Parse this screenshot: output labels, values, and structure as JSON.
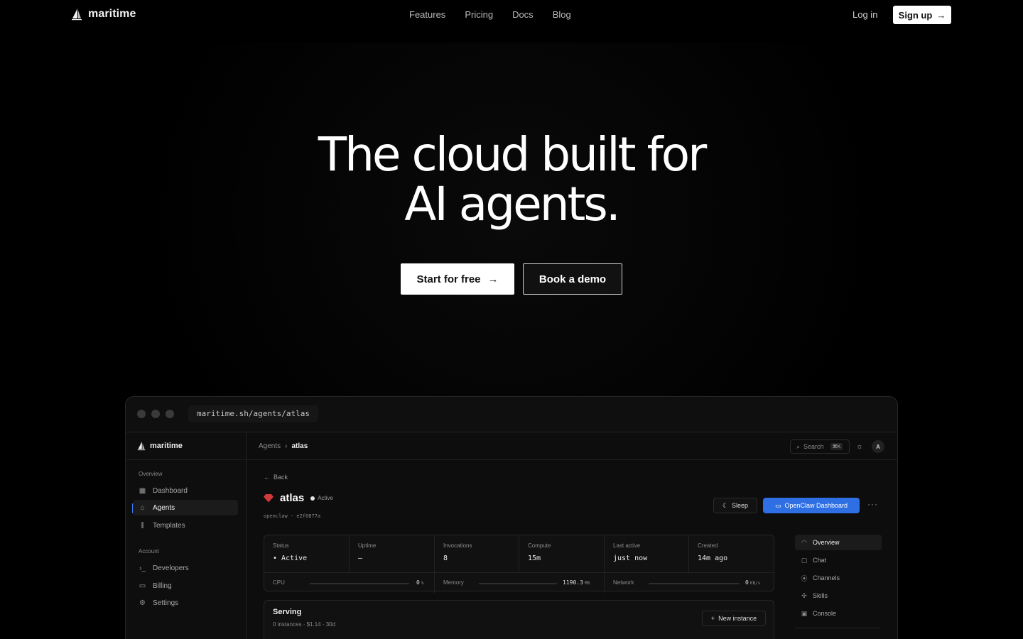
{
  "nav": {
    "brand": "maritime",
    "links": [
      "Features",
      "Pricing",
      "Docs",
      "Blog"
    ],
    "login": "Log in",
    "signup": "Sign up"
  },
  "hero": {
    "line1": "The cloud built for",
    "line2": "AI agents.",
    "cta_primary": "Start for free",
    "cta_secondary": "Book a demo"
  },
  "app": {
    "url": "maritime.sh/agents/atlas",
    "brand": "maritime",
    "sidebar": {
      "section_overview": "Overview",
      "section_account": "Account",
      "items_overview": [
        {
          "label": "Dashboard",
          "icon": "grid-icon"
        },
        {
          "label": "Agents",
          "icon": "robot-icon",
          "active": true
        },
        {
          "label": "Templates",
          "icon": "library-icon"
        }
      ],
      "items_account": [
        {
          "label": "Developers",
          "icon": "terminal-icon"
        },
        {
          "label": "Billing",
          "icon": "card-icon"
        },
        {
          "label": "Settings",
          "icon": "gear-icon"
        }
      ]
    },
    "breadcrumb": {
      "parent": "Agents",
      "current": "atlas"
    },
    "search": {
      "label": "Search",
      "shortcut": "⌘K"
    },
    "avatar": "A",
    "back": "Back",
    "agent": {
      "name": "atlas",
      "status": "Active",
      "meta": "openclaw · e2f0877a"
    },
    "actions": {
      "sleep": "Sleep",
      "dashboard": "OpenClaw Dashboard"
    },
    "stats": [
      {
        "label": "Status",
        "value": "Active"
      },
      {
        "label": "Uptime",
        "value": "–"
      },
      {
        "label": "Invocations",
        "value": "8"
      },
      {
        "label": "Compute",
        "value": "15m"
      },
      {
        "label": "Last active",
        "value": "just now"
      },
      {
        "label": "Created",
        "value": "14m ago"
      }
    ],
    "meters": [
      {
        "label": "CPU",
        "value": "0",
        "unit": "%"
      },
      {
        "label": "Memory",
        "value": "1190.3",
        "unit": "MB"
      },
      {
        "label": "Network",
        "value": "0",
        "unit": "KB/s"
      }
    ],
    "serving": {
      "title": "Serving",
      "subtitle": "0 instances · $1.14 · 30d",
      "new_instance": "New instance"
    },
    "subnav": [
      {
        "label": "Overview",
        "icon": "gauge-icon",
        "active": true
      },
      {
        "label": "Chat",
        "icon": "chat-icon"
      },
      {
        "label": "Channels",
        "icon": "broadcast-icon"
      },
      {
        "label": "Skills",
        "icon": "puzzle-icon"
      },
      {
        "label": "Console",
        "icon": "console-icon"
      }
    ]
  }
}
